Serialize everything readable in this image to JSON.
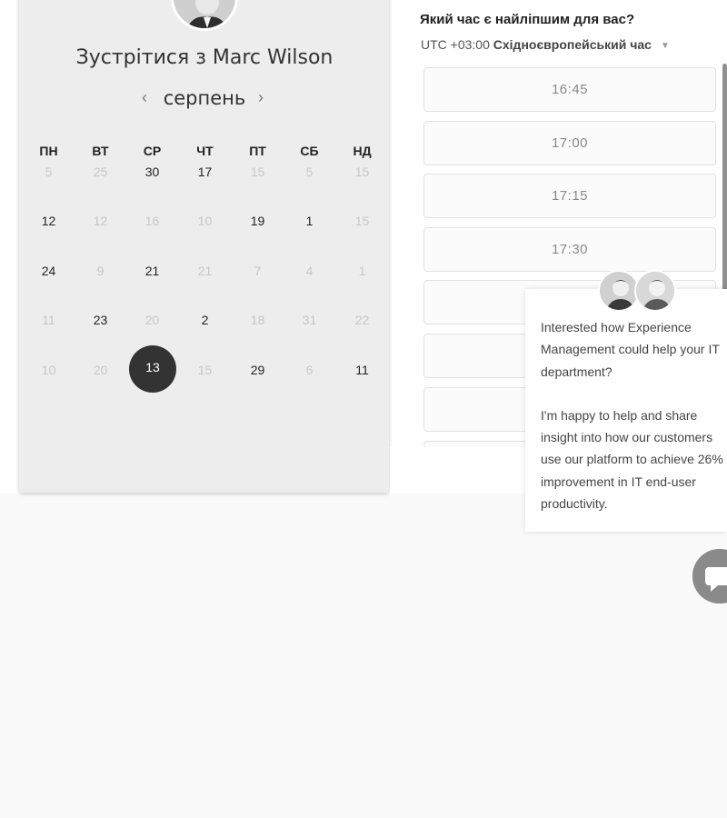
{
  "calendar": {
    "title": "Зустрітися з Marc Wilson",
    "month": "серпень",
    "weekdays": [
      "ПН",
      "ВТ",
      "СР",
      "ЧТ",
      "ПТ",
      "СБ",
      "НД"
    ],
    "rows": [
      [
        "5",
        "25",
        "30",
        "17",
        "15",
        "5",
        "15"
      ],
      [
        "12",
        "12",
        "16",
        "10",
        "19",
        "1",
        "15"
      ],
      [
        "24",
        "9",
        "21",
        "21",
        "7",
        "4",
        "1"
      ],
      [
        "11",
        "23",
        "20",
        "2",
        "18",
        "31",
        "22"
      ],
      [
        "10",
        "20",
        "13",
        "15",
        "29",
        "6",
        "11"
      ]
    ],
    "selected_day": "13"
  },
  "times": {
    "heading": "Який час є найліпшим для вас?",
    "timezone_prefix": "UTC +03:00",
    "timezone_name": "Східноєвропейський час",
    "slots": [
      "16:45",
      "17:00",
      "17:15",
      "17:30"
    ]
  },
  "chat": {
    "message_1": "Interested how Experience Management could help your IT department?",
    "message_2": "I'm happy to help and share insight into how our customers use our platform to achieve 26% improvement in IT end-user productivity."
  },
  "icons": {
    "month_prev": "‹",
    "month_next": "›",
    "tz_caret": "▼"
  }
}
